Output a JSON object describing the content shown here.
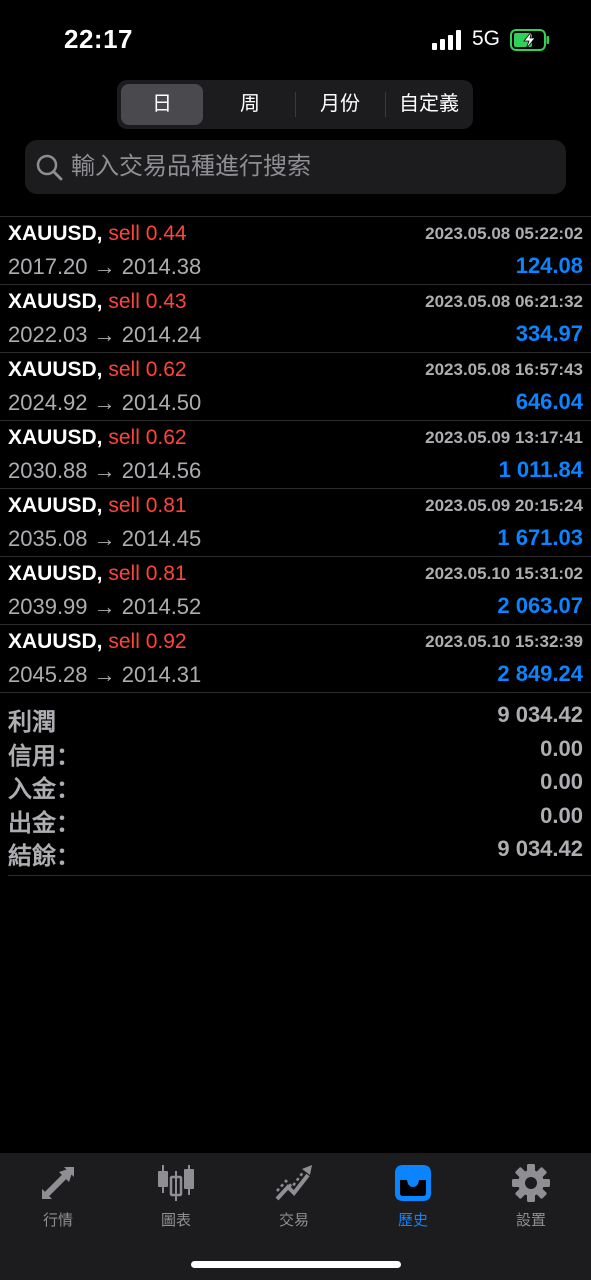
{
  "status": {
    "time": "22:17",
    "network": "5G"
  },
  "period_tabs": [
    {
      "label": "日",
      "active": true
    },
    {
      "label": "周",
      "active": false
    },
    {
      "label": "月份",
      "active": false
    },
    {
      "label": "自定義",
      "active": false
    }
  ],
  "search": {
    "placeholder": "輸入交易品種進行搜索"
  },
  "trades": [
    {
      "symbol": "XAUUSD,",
      "side": "sell",
      "lots": "0.44",
      "datetime": "2023.05.08 05:22:02",
      "prices": "2017.20 → 2014.38",
      "profit": "124.08"
    },
    {
      "symbol": "XAUUSD,",
      "side": "sell",
      "lots": "0.43",
      "datetime": "2023.05.08 06:21:32",
      "prices": "2022.03 → 2014.24",
      "profit": "334.97"
    },
    {
      "symbol": "XAUUSD,",
      "side": "sell",
      "lots": "0.62",
      "datetime": "2023.05.08 16:57:43",
      "prices": "2024.92 → 2014.50",
      "profit": "646.04"
    },
    {
      "symbol": "XAUUSD,",
      "side": "sell",
      "lots": "0.62",
      "datetime": "2023.05.09 13:17:41",
      "prices": "2030.88 → 2014.56",
      "profit": "1 011.84"
    },
    {
      "symbol": "XAUUSD,",
      "side": "sell",
      "lots": "0.81",
      "datetime": "2023.05.09 20:15:24",
      "prices": "2035.08 → 2014.45",
      "profit": "1 671.03"
    },
    {
      "symbol": "XAUUSD,",
      "side": "sell",
      "lots": "0.81",
      "datetime": "2023.05.10 15:31:02",
      "prices": "2039.99 → 2014.52",
      "profit": "2 063.07"
    },
    {
      "symbol": "XAUUSD,",
      "side": "sell",
      "lots": "0.92",
      "datetime": "2023.05.10 15:32:39",
      "prices": "2045.28 → 2014.31",
      "profit": "2 849.24"
    }
  ],
  "summary": [
    {
      "label": "利潤",
      "value": "9 034.42"
    },
    {
      "label": "信用：",
      "value": "0.00"
    },
    {
      "label": "入金：",
      "value": "0.00"
    },
    {
      "label": "出金：",
      "value": "0.00"
    },
    {
      "label": "結餘：",
      "value": "9 034.42"
    }
  ],
  "tabbar": [
    {
      "label": "行情",
      "icon": "quotes-arrows-icon",
      "active": false
    },
    {
      "label": "圖表",
      "icon": "candlestick-chart-icon",
      "active": false
    },
    {
      "label": "交易",
      "icon": "trade-trend-icon",
      "active": false
    },
    {
      "label": "歷史",
      "icon": "history-inbox-icon",
      "active": true
    },
    {
      "label": "設置",
      "icon": "gear-icon",
      "active": false
    }
  ],
  "colors": {
    "sell": "#ff453a",
    "profit": "#0a84ff",
    "active_tab": "#0a84ff",
    "inactive_tab": "#8e8e93",
    "charging": "#30d158"
  }
}
